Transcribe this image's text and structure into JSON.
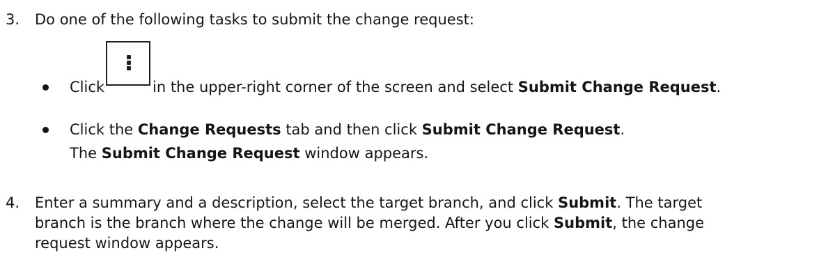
{
  "steps": [
    {
      "number": "3.",
      "text": "Do one of the following tasks to submit the change request:",
      "options": [
        {
          "click_prefix": "Click",
          "icon": "kebab-menu-icon",
          "middle": "in the upper-right corner of the screen and select",
          "menu_item": "Submit Change Request",
          "end": "."
        },
        {
          "prefix": "Click the",
          "tab": "Change Requests",
          "middle": "tab and then click",
          "action": "Submit Change Request",
          "end": ".",
          "result_prefix": "The",
          "result_window": "Submit Change Request",
          "result_suffix": "window appears."
        }
      ]
    },
    {
      "number": "4.",
      "line1_prefix": "Enter a summary and a description, select the target branch, and click",
      "line1_bold": "Submit",
      "line1_suffix": ". The target",
      "line2_prefix": "branch is the branch where the change will be merged. After you click",
      "line2_bold": "Submit",
      "line2_suffix": ", the change",
      "line3": "request window appears."
    }
  ]
}
